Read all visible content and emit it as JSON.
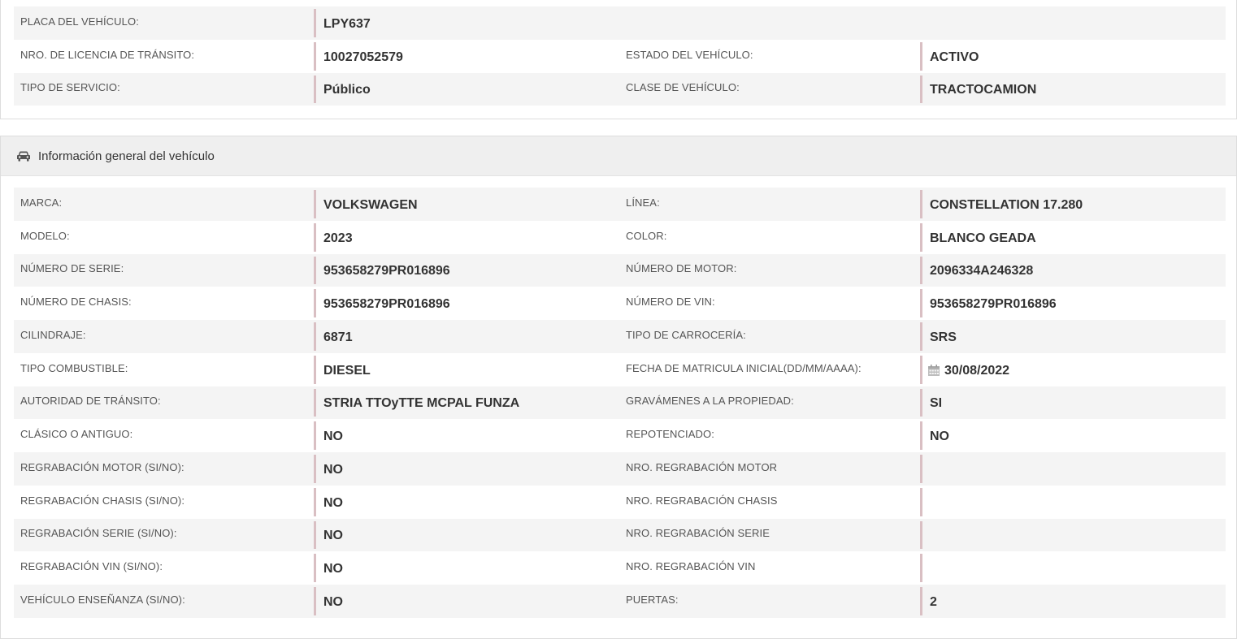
{
  "top_panel": {
    "rows": [
      {
        "l1": "PLACA DEL VEHÍCULO:",
        "v1": "LPY637",
        "l2": "",
        "v2": ""
      },
      {
        "l1": "NRO. DE LICENCIA DE TRÁNSITO:",
        "v1": "10027052579",
        "l2": "ESTADO DEL VEHÍCULO:",
        "v2": "ACTIVO"
      },
      {
        "l1": "TIPO DE SERVICIO:",
        "v1": "Público",
        "l2": "CLASE DE VEHÍCULO:",
        "v2": "TRACTOCAMION"
      }
    ]
  },
  "general_panel": {
    "title": "Información general del vehículo",
    "icon": "car-icon",
    "rows": [
      {
        "l1": "MARCA:",
        "v1": "VOLKSWAGEN",
        "l2": "LÍNEA:",
        "v2": "CONSTELLATION 17.280"
      },
      {
        "l1": "MODELO:",
        "v1": "2023",
        "l2": "COLOR:",
        "v2": "BLANCO GEADA"
      },
      {
        "l1": "NÚMERO DE SERIE:",
        "v1": "953658279PR016896",
        "l2": "NÚMERO DE MOTOR:",
        "v2": "2096334A246328"
      },
      {
        "l1": "NÚMERO DE CHASIS:",
        "v1": "953658279PR016896",
        "l2": "NÚMERO DE VIN:",
        "v2": "953658279PR016896"
      },
      {
        "l1": "CILINDRAJE:",
        "v1": "6871",
        "l2": "TIPO DE CARROCERÍA:",
        "v2": "SRS"
      },
      {
        "l1": "TIPO COMBUSTIBLE:",
        "v1": "DIESEL",
        "l2": "FECHA DE MATRICULA INICIAL(DD/MM/AAAA):",
        "v2": "30/08/2022"
      },
      {
        "l1": "AUTORIDAD DE TRÁNSITO:",
        "v1": "STRIA TTOyTTE MCPAL FUNZA",
        "l2": "GRAVÁMENES A LA PROPIEDAD:",
        "v2": "SI"
      },
      {
        "l1": "CLÁSICO O ANTIGUO:",
        "v1": "NO",
        "l2": "REPOTENCIADO:",
        "v2": "NO"
      },
      {
        "l1": "REGRABACIÓN MOTOR (SI/NO):",
        "v1": "NO",
        "l2": "NRO. REGRABACIÓN MOTOR",
        "v2": ""
      },
      {
        "l1": "REGRABACIÓN CHASIS (SI/NO):",
        "v1": "NO",
        "l2": "NRO. REGRABACIÓN CHASIS",
        "v2": ""
      },
      {
        "l1": "REGRABACIÓN SERIE (SI/NO):",
        "v1": "NO",
        "l2": "NRO. REGRABACIÓN SERIE",
        "v2": ""
      },
      {
        "l1": "REGRABACIÓN VIN (SI/NO):",
        "v1": "NO",
        "l2": "NRO. REGRABACIÓN VIN",
        "v2": ""
      },
      {
        "l1": "VEHÍCULO ENSEÑANZA (SI/NO):",
        "v1": "NO",
        "l2": "PUERTAS:",
        "v2": "2"
      }
    ]
  },
  "colors": {
    "row_stripe": "#f4f4f4",
    "value_bar": "#d9bfc3",
    "heading_bg": "#efefef"
  }
}
